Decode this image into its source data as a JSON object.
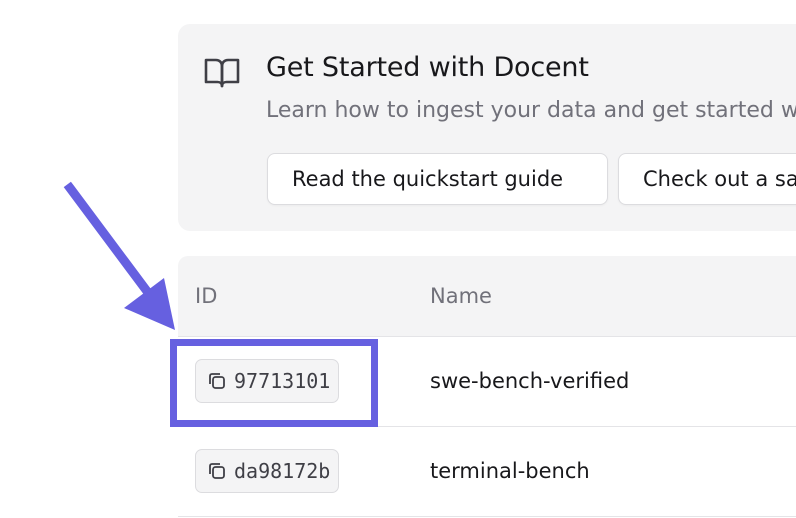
{
  "card": {
    "icon": "book-open-icon",
    "title": "Get Started with Docent",
    "description": "Learn how to ingest your data and get started w",
    "buttons": [
      {
        "label": "Read the quickstart guide"
      },
      {
        "label": "Check out a sa"
      }
    ]
  },
  "table": {
    "columns": [
      "ID",
      "Name"
    ],
    "rows": [
      {
        "id": "97713101",
        "name": "swe-bench-verified",
        "icon": "copy-icon"
      },
      {
        "id": "da98172b",
        "name": "terminal-bench",
        "icon": "copy-icon"
      }
    ]
  },
  "annotation": {
    "arrow_icon": "arrow-down-right-icon",
    "highlight_color": "#6660e0"
  },
  "colors": {
    "card_background": "#f4f4f5",
    "header_text": "#71717a",
    "annotation": "#6660e0"
  }
}
